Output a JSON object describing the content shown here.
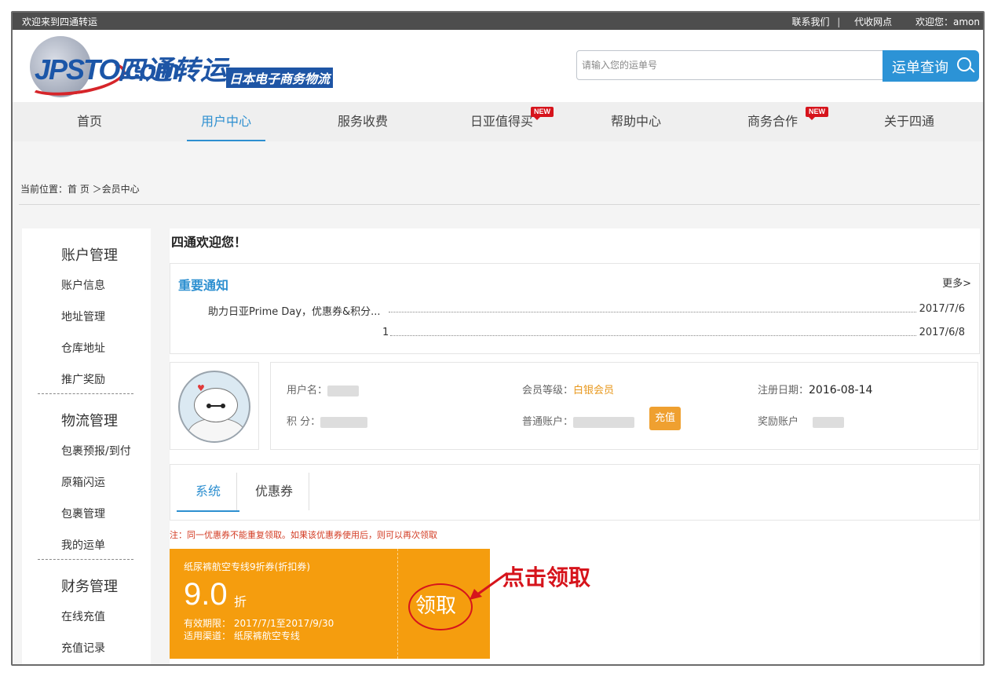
{
  "topbar": {
    "welcome": "欢迎来到四通转运",
    "contact": "联系我们",
    "separator": "|",
    "agent": "代收网点",
    "greeting": "欢迎您：amon"
  },
  "logo": {
    "latin": "JPSTO.com",
    "cn": "四通转运",
    "sub": "日本电子商务物流"
  },
  "search": {
    "placeholder": "请输入您的运单号",
    "button": "运单查询",
    "icon": "search-icon"
  },
  "nav": {
    "items": [
      {
        "label": "首页"
      },
      {
        "label": "用户中心",
        "active": true
      },
      {
        "label": "服务收费"
      },
      {
        "label": "日亚值得买",
        "badge": "NEW"
      },
      {
        "label": "帮助中心"
      },
      {
        "label": "商务合作",
        "badge": "NEW"
      },
      {
        "label": "关于四通"
      }
    ]
  },
  "breadcrumb": "当前位置：首 页 ＞会员中心",
  "sidebar": {
    "groups": [
      {
        "title": "账户管理",
        "links": [
          "账户信息",
          "地址管理",
          "仓库地址",
          "推广奖励"
        ]
      },
      {
        "title": "物流管理",
        "links": [
          "包裹预报/到付",
          "原箱闪运",
          "包裹管理",
          "我的运单"
        ]
      },
      {
        "title": "财务管理",
        "links": [
          "在线充值",
          "充值记录"
        ]
      }
    ]
  },
  "main": {
    "welcome": "四通欢迎您！",
    "notice": {
      "title": "重要通知",
      "more": "更多>",
      "rows": [
        {
          "text": "助力日亚Prime Day，优惠券&积分...",
          "date": "2017/7/6"
        },
        {
          "text": "1",
          "date": "2017/6/8"
        }
      ]
    },
    "user": {
      "username_label": "用户名：",
      "level_label": "会员等级：",
      "level": "白银会员",
      "reg_label": "注册日期：",
      "reg_date": "2016-08-14",
      "points_label": "积  分：",
      "account_label": "普通账户：",
      "recharge": "充值",
      "reward_label": "奖励账户"
    },
    "tabs": [
      {
        "label": "系统",
        "active": true
      },
      {
        "label": "优惠券"
      }
    ],
    "note": "注：同一优惠券不能重复领取。如果该优惠券使用后，则可以再次领取",
    "coupon": {
      "name": "纸尿裤航空专线9折券(折扣券)",
      "value": "9.0",
      "unit": "折",
      "validity": "有效期限：  2017/7/1至2017/9/30",
      "channel": "适用渠道：  纸尿裤航空专线",
      "claim": "领取"
    },
    "annotation": "点击领取"
  },
  "colors": {
    "accent": "#2d8fd0",
    "coupon": "#f59d0e",
    "highlight_red": "#d6141c",
    "topbar": "#4d4d4d"
  }
}
